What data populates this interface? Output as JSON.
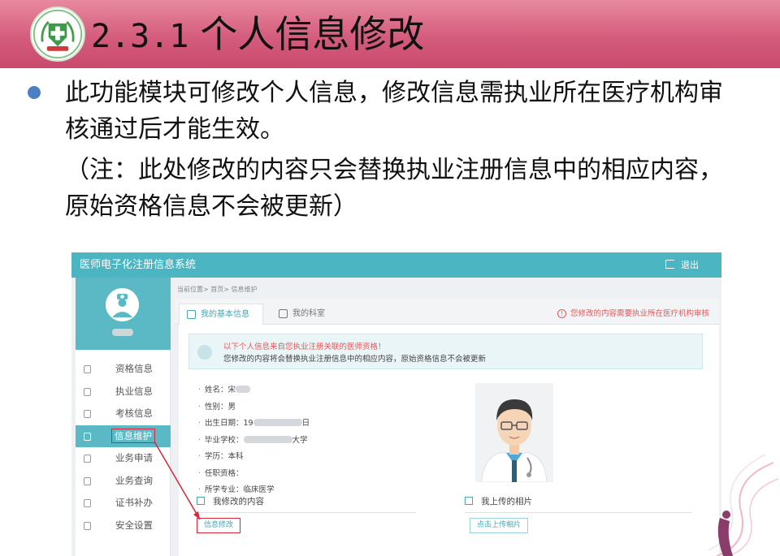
{
  "slide": {
    "section_number": "2.3.1",
    "title": "个人信息修改",
    "paragraph": "此功能模块可修改个人信息，修改信息需执业所在医疗机构审核通过后才能生效。",
    "note": "（注：此处修改的内容只会替换执业注册信息中的相应内容，原始资格信息不会被更新）",
    "colors": {
      "header_band": "#d45c7c",
      "bullet": "#4f7fc3",
      "app_accent": "#4bb5c1",
      "annotation": "#d9263a"
    },
    "icons": {
      "logo": "medical-cross-emblem",
      "bullet": "bullet-dot"
    }
  },
  "app": {
    "title": "医师电子化注册信息系统",
    "logout": "退出",
    "breadcrumb": "当前位置> 首页> 信息维护",
    "sidebar": {
      "items": [
        {
          "label": "资格信息",
          "icon": "document-icon",
          "active": false
        },
        {
          "label": "执业信息",
          "icon": "headset-icon",
          "active": false
        },
        {
          "label": "考核信息",
          "icon": "clipboard-icon",
          "active": false
        },
        {
          "label": "信息维护",
          "icon": "card-icon",
          "active": true
        },
        {
          "label": "业务申请",
          "icon": "edit-icon",
          "active": false
        },
        {
          "label": "业务查询",
          "icon": "search-doc-icon",
          "active": false
        },
        {
          "label": "证书补办",
          "icon": "certificate-icon",
          "active": false
        },
        {
          "label": "安全设置",
          "icon": "user-lock-icon",
          "active": false
        }
      ]
    },
    "tabs": [
      {
        "label": "我的基本信息",
        "active": true
      },
      {
        "label": "我的科室",
        "active": false
      }
    ],
    "tabs_warning": "您修改的内容需要执业所在医疗机构审核",
    "notice": {
      "line1": "以下个人信息来自您执业注册关联的医师资格！",
      "line2": "您修改的内容将会替换执业注册信息中的相应内容，原始资格信息不会被更新"
    },
    "info": [
      {
        "label": "姓名：",
        "value": "宋"
      },
      {
        "label": "性别：",
        "value": "男"
      },
      {
        "label": "出生日期：",
        "value": "19",
        "suffix": "日"
      },
      {
        "label": "毕业学校：",
        "value": "",
        "suffix": "大学"
      },
      {
        "label": "学历：",
        "value": "本科"
      },
      {
        "label": "任职资格：",
        "value": ""
      },
      {
        "label": "所学专业：",
        "value": "临床医学"
      }
    ],
    "sections": {
      "my_changes": "我修改的内容",
      "my_photos": "我上传的相片"
    },
    "buttons": {
      "edit": "信息修改",
      "upload": "点击上传相片"
    }
  }
}
